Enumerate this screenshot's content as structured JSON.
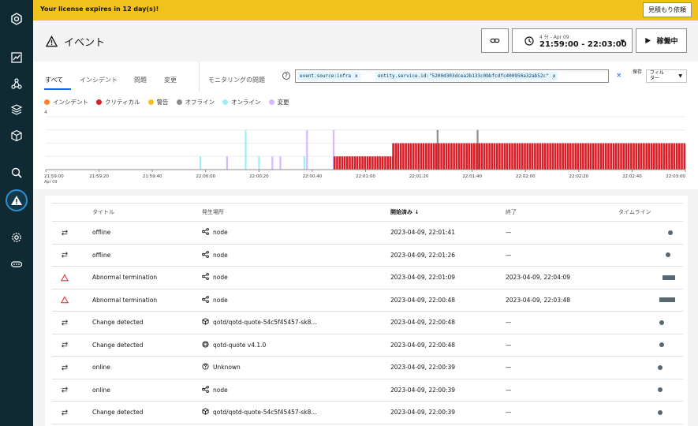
{
  "banner": {
    "text": "Your license expires in 12 day(s)!",
    "quote_button": "見積もり依頼"
  },
  "header": {
    "title": "イベント",
    "time_top": "4 分 - Apr 09",
    "time_range": "21:59:00 - 22:03:00",
    "status_button": "稼働中"
  },
  "tabs": [
    {
      "label": "すべて",
      "active": true
    },
    {
      "label": "インシデント",
      "active": false
    },
    {
      "label": "問題",
      "active": false
    },
    {
      "label": "変更",
      "active": false
    },
    {
      "label": "モニタリングの問題",
      "active": false
    }
  ],
  "filter": {
    "help": "?",
    "tags": [
      {
        "text": "event.source:infra"
      },
      {
        "text": "entity.service.id:\"5200d303dcea2b133c0bbfcdfc400950a32ab52c\""
      }
    ],
    "clear": "×",
    "save_label": "保存",
    "filter_label": "フィル\nター"
  },
  "chart_data": {
    "type": "bar",
    "legend": [
      {
        "name": "インシデント",
        "color": "#ff832b"
      },
      {
        "name": "クリティカル",
        "color": "#da1e28"
      },
      {
        "name": "警告",
        "color": "#f1c21b"
      },
      {
        "name": "オフライン",
        "color": "#8d8d8d"
      },
      {
        "name": "オンライン",
        "color": "#9ef0f0"
      },
      {
        "name": "変更",
        "color": "#d4bbff"
      }
    ],
    "y_max_label": "4",
    "ylim": [
      0,
      4
    ],
    "x_ticks": [
      "21:59:00",
      "21:59:20",
      "21:59:40",
      "22:00:00",
      "22:00:20",
      "22:00:40",
      "22:01:00",
      "22:01:20",
      "22:01:40",
      "22:02:00",
      "22:02:20",
      "22:02:40",
      "22:03:00"
    ],
    "x_sub_label": "Apr 09",
    "critical_bands": [
      {
        "start_sec": 108,
        "end_sec": 130,
        "value": 1
      },
      {
        "start_sec": 130,
        "end_sec": 240,
        "value": 2
      }
    ],
    "spikes": [
      {
        "sec": 58,
        "value": 1,
        "series": "オンライン"
      },
      {
        "sec": 68,
        "value": 1,
        "series": "変更"
      },
      {
        "sec": 75,
        "value": 3,
        "series": "オンライン"
      },
      {
        "sec": 80,
        "value": 1,
        "series": "オンライン"
      },
      {
        "sec": 85,
        "value": 1,
        "series": "変更"
      },
      {
        "sec": 88,
        "value": 1,
        "series": "変更"
      },
      {
        "sec": 97,
        "value": 1,
        "series": "オンライン"
      },
      {
        "sec": 98,
        "value": 3,
        "series": "変更"
      },
      {
        "sec": 108,
        "value": 3,
        "series": "変更"
      },
      {
        "sec": 147,
        "value": 3,
        "series": "オフライン"
      },
      {
        "sec": 162,
        "value": 3,
        "series": "オフライン"
      }
    ]
  },
  "table": {
    "headers": [
      "タイトル",
      "発生場所",
      "開始済み",
      "終了",
      "タイムライン"
    ],
    "sort_indicator": "↓",
    "rows": [
      {
        "type": "change",
        "title": "offline",
        "location_icon": "node",
        "location": "node",
        "start": "2023-04-09, 22:01:41",
        "end": "—",
        "tl_start_pct": 0.88,
        "tl_len_pct": 0
      },
      {
        "type": "change",
        "title": "offline",
        "location_icon": "node",
        "location": "node",
        "start": "2023-04-09, 22:01:26",
        "end": "—",
        "tl_start_pct": 0.83,
        "tl_len_pct": 0
      },
      {
        "type": "incident",
        "title": "Abnormal termination",
        "location_icon": "node",
        "location": "node",
        "start": "2023-04-09, 22:01:09",
        "end": "2023-04-09, 22:04:09",
        "tl_start_pct": 0.78,
        "tl_len_pct": 0.22
      },
      {
        "type": "incident",
        "title": "Abnormal termination",
        "location_icon": "node",
        "location": "node",
        "start": "2023-04-09, 22:00:48",
        "end": "2023-04-09, 22:03:48",
        "tl_start_pct": 0.72,
        "tl_len_pct": 0.28
      },
      {
        "type": "change",
        "title": "Change detected",
        "location_icon": "pod",
        "location": "qotd/qotd-quote-54c5f45457-sk8...",
        "start": "2023-04-09, 22:00:48",
        "end": "—",
        "tl_start_pct": 0.72,
        "tl_len_pct": 0
      },
      {
        "type": "change",
        "title": "Change detected",
        "location_icon": "deployment",
        "location": "qotd-quote v4.1.0",
        "start": "2023-04-09, 22:00:48",
        "end": "—",
        "tl_start_pct": 0.72,
        "tl_len_pct": 0
      },
      {
        "type": "change",
        "title": "online",
        "location_icon": "unknown",
        "location": "Unknown",
        "start": "2023-04-09, 22:00:39",
        "end": "—",
        "tl_start_pct": 0.69,
        "tl_len_pct": 0
      },
      {
        "type": "change",
        "title": "online",
        "location_icon": "node",
        "location": "node",
        "start": "2023-04-09, 22:00:39",
        "end": "—",
        "tl_start_pct": 0.69,
        "tl_len_pct": 0
      },
      {
        "type": "change",
        "title": "Change detected",
        "location_icon": "pod",
        "location": "qotd/qotd-quote-54c5f45457-sk8...",
        "start": "2023-04-09, 22:00:39",
        "end": "—",
        "tl_start_pct": 0.69,
        "tl_len_pct": 0
      }
    ]
  }
}
